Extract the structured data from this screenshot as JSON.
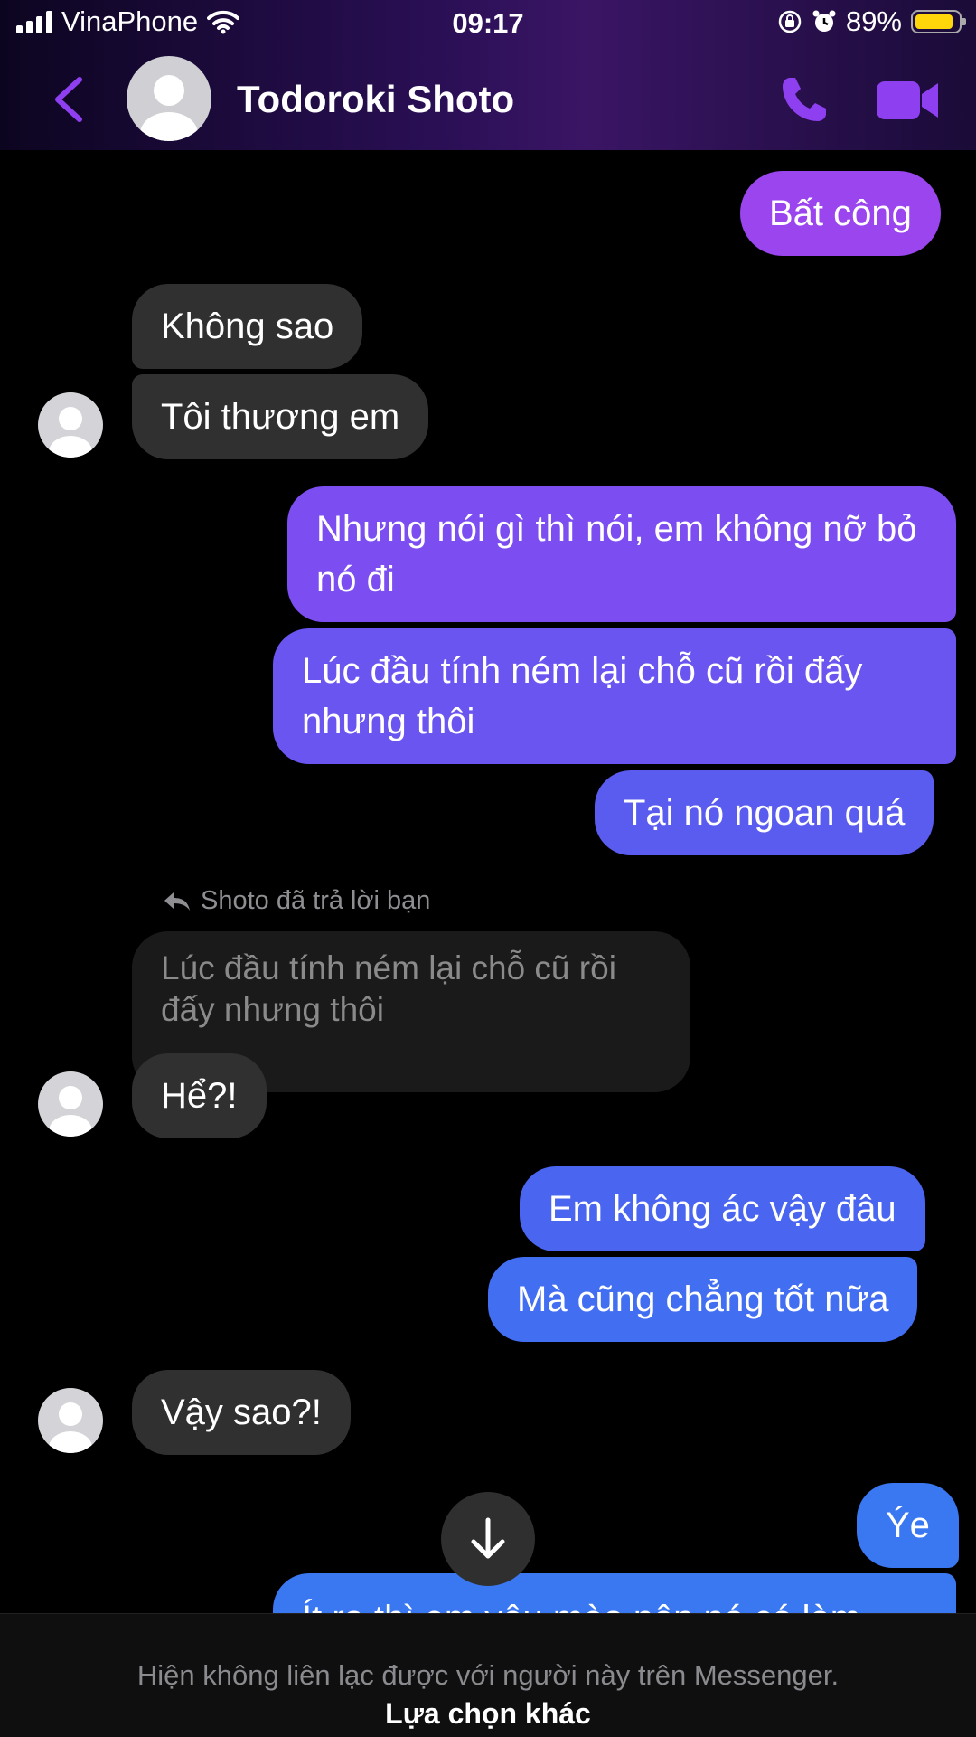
{
  "status_bar": {
    "carrier": "VinaPhone",
    "time": "09:17",
    "battery": "89%",
    "icons": [
      "signal-icon",
      "wifi-icon",
      "orientation-lock-icon",
      "alarm-icon",
      "battery-icon"
    ]
  },
  "header": {
    "contact_name": "Todoroki Shoto",
    "icons": [
      "back-icon",
      "avatar-icon",
      "phone-icon",
      "video-icon"
    ],
    "accent_color": "#8e3ff0"
  },
  "messages": [
    {
      "from": "me",
      "text": "Bất công"
    },
    {
      "from": "them",
      "text": "Không sao"
    },
    {
      "from": "them",
      "text": "Tôi thương em"
    },
    {
      "from": "me",
      "text": "Nhưng nói gì thì nói, em không nỡ bỏ nó đi"
    },
    {
      "from": "me",
      "text": "Lúc đầu tính ném lại chỗ cũ rồi đấy nhưng thôi"
    },
    {
      "from": "me",
      "text": "Tại nó ngoan quá"
    },
    {
      "from": "them",
      "text": "Hể?!"
    },
    {
      "from": "me",
      "text": "Em không ác vậy đâu"
    },
    {
      "from": "me",
      "text": "Mà cũng chẳng tốt nữa"
    },
    {
      "from": "them",
      "text": "Vậy sao?!"
    },
    {
      "from": "me",
      "text": "Ýe"
    },
    {
      "from": "me",
      "text": "Ít ra thì em yêu mèo nên nó có làm"
    }
  ],
  "reply": {
    "label": "Shoto đã trả lời bạn",
    "quoted_text": "Lúc đầu tính ném lại chỗ cũ rồi đấy nhưng thôi"
  },
  "footer": {
    "note": "Hiện không liên lạc được với người này trên Messenger.",
    "link": "Lựa chọn khác"
  },
  "colors": {
    "incoming_bubble": "#303030",
    "outgoing_top": "#9a45ee",
    "outgoing_bottom": "#3a78f2",
    "background": "#000000"
  }
}
